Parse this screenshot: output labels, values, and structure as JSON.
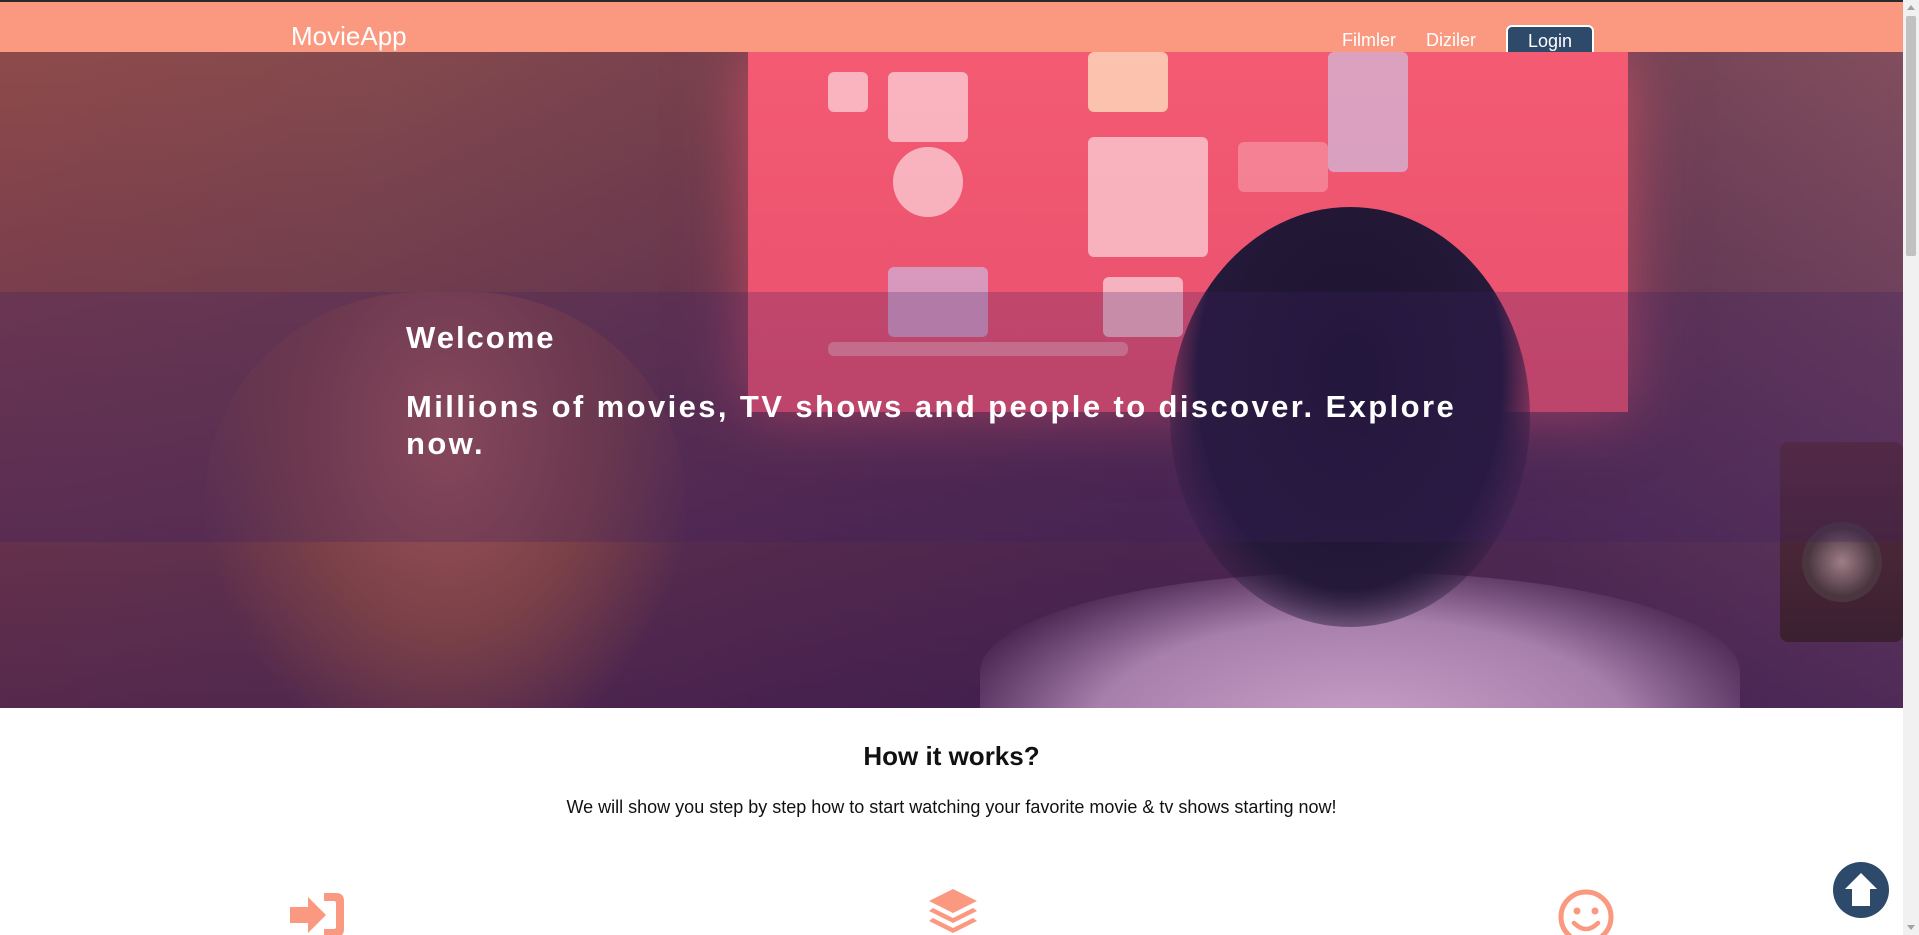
{
  "navbar": {
    "brand": "MovieApp",
    "links": [
      {
        "label": "Filmler"
      },
      {
        "label": "Diziler"
      }
    ],
    "login_label": "Login",
    "background_color": "#fa9880",
    "login_color": "#2e4a6b"
  },
  "hero": {
    "welcome": "Welcome",
    "tagline": "Millions of movies, TV shows and people to discover. Explore now."
  },
  "how_it_works": {
    "title": "How it works?",
    "description": "We will show you step by step how to start watching your favorite movie & tv shows starting now!",
    "steps": [
      {
        "icon": "sign-in-icon"
      },
      {
        "icon": "layers-icon"
      },
      {
        "icon": "smile-icon"
      }
    ],
    "icon_color": "#fa9880"
  },
  "scroll_top": {
    "icon": "arrow-up-circle-icon",
    "color": "#2e4a6b"
  }
}
